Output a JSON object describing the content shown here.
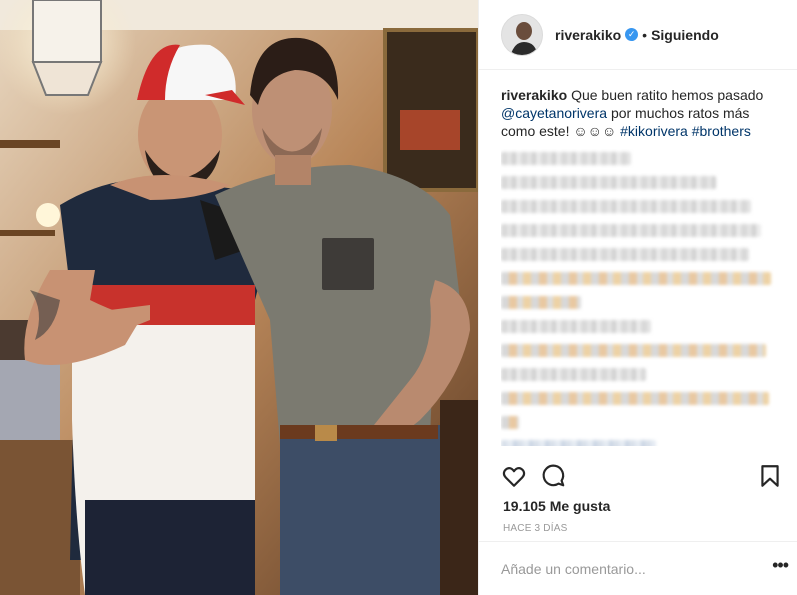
{
  "post": {
    "username": "riverakiko",
    "verified_icon": "verified-badge-icon",
    "follow_status": "Siguiendo",
    "separator": "•"
  },
  "caption": {
    "username": "riverakiko",
    "text_1": "Que buen ratito hemos pasado",
    "mention": "@cayetanorivera",
    "text_2": "por muchos ratos más como este! ☺☺☺",
    "hashtag_1": "#kikorivera",
    "hashtag_2": "#brothers"
  },
  "actions": {
    "like_icon": "heart-outline-icon",
    "comment_icon": "comment-bubble-icon",
    "save_icon": "bookmark-icon"
  },
  "likes_label": "19.105 Me gusta",
  "time_label": "HACE 3 DÍAS",
  "comment_input": {
    "placeholder": "Añade un comentario..."
  },
  "more_label": "•••",
  "colors": {
    "link": "#003569",
    "verified": "#3897f0",
    "muted": "#999999"
  }
}
